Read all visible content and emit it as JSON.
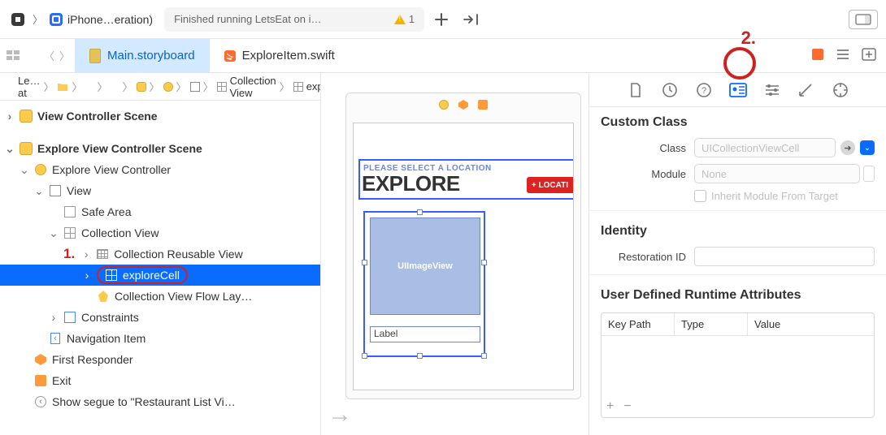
{
  "topbar": {
    "stop_icon": "stop-icon",
    "sim_label": "iPhone…eration)",
    "status": "Finished running LetsEat on i…",
    "warn_count": "1"
  },
  "tabs": {
    "active": "Main.storyboard",
    "other": "ExploreItem.swift"
  },
  "jumpbar": {
    "items": [
      "Le…at",
      "",
      "",
      "",
      "",
      "",
      "",
      "Collection View",
      "exploreCell"
    ]
  },
  "outline": {
    "scene1": "View Controller Scene",
    "scene2": "Explore View Controller Scene",
    "ctrl": "Explore View Controller",
    "view": "View",
    "safe": "Safe Area",
    "coll": "Collection View",
    "reuse": "Collection Reusable View",
    "cell": "exploreCell",
    "flow": "Collection View Flow Lay…",
    "cons": "Constraints",
    "nav": "Navigation Item",
    "resp": "First Responder",
    "exit": "Exit",
    "segue": "Show segue to \"Restaurant List Vi…",
    "annot1": "1."
  },
  "canvas": {
    "header_sub": "PLEASE SELECT A LOCATION",
    "header_title": "EXPLORE",
    "loc_badge": "+ LOCATI",
    "img_label": "UIImageView",
    "cell_label": "Label"
  },
  "annot2": "2.",
  "inspector": {
    "section_class": "Custom Class",
    "class_label": "Class",
    "class_value": "UICollectionViewCell",
    "module_label": "Module",
    "module_value": "None",
    "inherit": "Inherit Module From Target",
    "section_identity": "Identity",
    "restoration_label": "Restoration ID",
    "section_udr": "User Defined Runtime Attributes",
    "udr_cols": {
      "keypath": "Key Path",
      "type": "Type",
      "value": "Value"
    }
  }
}
